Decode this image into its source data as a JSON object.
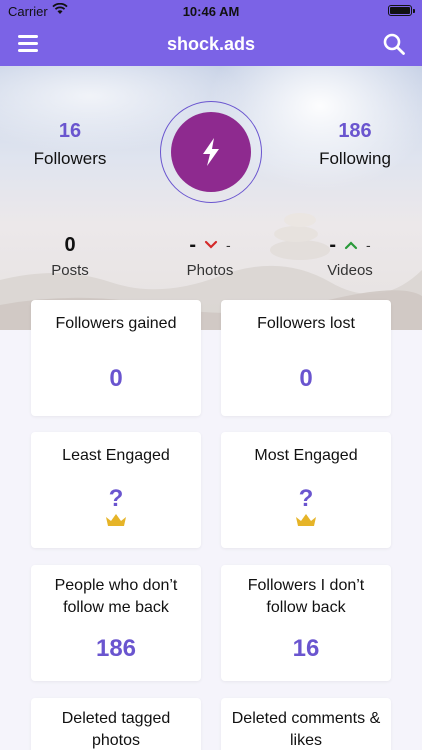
{
  "status_bar": {
    "carrier": "Carrier",
    "time": "10:46 AM"
  },
  "nav": {
    "title": "shock.ads",
    "menu_icon": "hamburger-icon",
    "search_icon": "search-icon"
  },
  "profile": {
    "followers_count": "16",
    "followers_label": "Followers",
    "following_count": "186",
    "following_label": "Following",
    "avatar_icon": "lightning-icon"
  },
  "mini_stats": {
    "posts_value": "0",
    "posts_label": "Posts",
    "photos_value": "-",
    "photos_delta": "-",
    "photos_label": "Photos",
    "videos_value": "-",
    "videos_delta": "-",
    "videos_label": "Videos"
  },
  "cards": [
    {
      "title": "Followers gained",
      "value": "0"
    },
    {
      "title": "Followers lost",
      "value": "0"
    },
    {
      "title": "Least Engaged",
      "value": "?"
    },
    {
      "title": "Most Engaged",
      "value": "?"
    },
    {
      "title": "People who don’t follow me back",
      "value": "186"
    },
    {
      "title": "Followers I don’t follow back",
      "value": "16"
    },
    {
      "title": "Deleted tagged photos",
      "value": ""
    },
    {
      "title": "Deleted comments & likes",
      "value": ""
    }
  ],
  "colors": {
    "accent": "#7b63e6",
    "value": "#6a55cf",
    "avatar": "#8e2a8f",
    "down": "#d42a2a",
    "up": "#2a9a3a"
  }
}
